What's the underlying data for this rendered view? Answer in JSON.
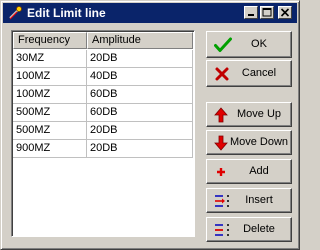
{
  "window": {
    "title": "Edit Limit line"
  },
  "table": {
    "columns": [
      "Frequency",
      "Amplitude"
    ],
    "rows": [
      {
        "frequency": "30MZ",
        "amplitude": "20DB"
      },
      {
        "frequency": "100MZ",
        "amplitude": "40DB"
      },
      {
        "frequency": "100MZ",
        "amplitude": "60DB"
      },
      {
        "frequency": "500MZ",
        "amplitude": "60DB"
      },
      {
        "frequency": "500MZ",
        "amplitude": "20DB"
      },
      {
        "frequency": "900MZ",
        "amplitude": "20DB"
      }
    ]
  },
  "buttons": {
    "ok": {
      "label": "OK",
      "icon": "checkmark-icon"
    },
    "cancel": {
      "label": "Cancel",
      "icon": "x-icon"
    },
    "move_up": {
      "label": "Move Up",
      "icon": "arrow-up-icon"
    },
    "move_down": {
      "label": "Move Down",
      "icon": "arrow-down-icon"
    },
    "add": {
      "label": "Add",
      "icon": "plus-icon"
    },
    "insert": {
      "label": "Insert",
      "icon": "insert-row-icon"
    },
    "delete": {
      "label": "Delete",
      "icon": "delete-row-icon"
    }
  },
  "colors": {
    "titlebar": "#0a246a",
    "face": "#d4d0c8",
    "ok_icon": "#00a000",
    "cancel_icon": "#c00000",
    "arrow_icon": "#e00000"
  }
}
